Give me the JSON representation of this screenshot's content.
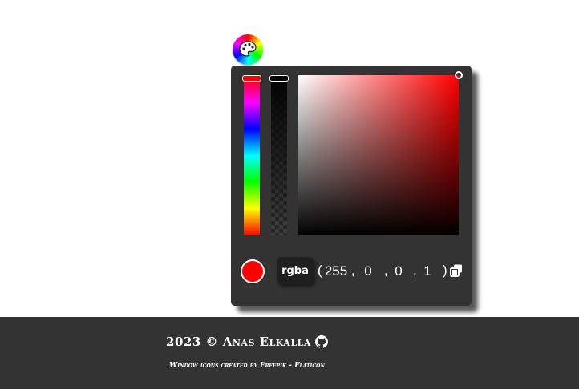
{
  "toggle": {
    "icon": "palette-icon"
  },
  "picker": {
    "hue_handle_color": "#ff0000",
    "alpha_handle_color": "#000000",
    "base_hue_color": "#ff0000",
    "swatch_color": "#ff0000",
    "format_label": "rgba",
    "open_paren": "(",
    "close_paren": ")",
    "separator": ",",
    "values": {
      "r": "255",
      "g": "0",
      "b": "0",
      "a": "1"
    },
    "copy_icon": "copy-icon"
  },
  "footer": {
    "copyright": "2023 © Anas Elkalla",
    "github_icon": "github-icon",
    "credit_text": "Window icons created by Freepik - Flaticon"
  }
}
